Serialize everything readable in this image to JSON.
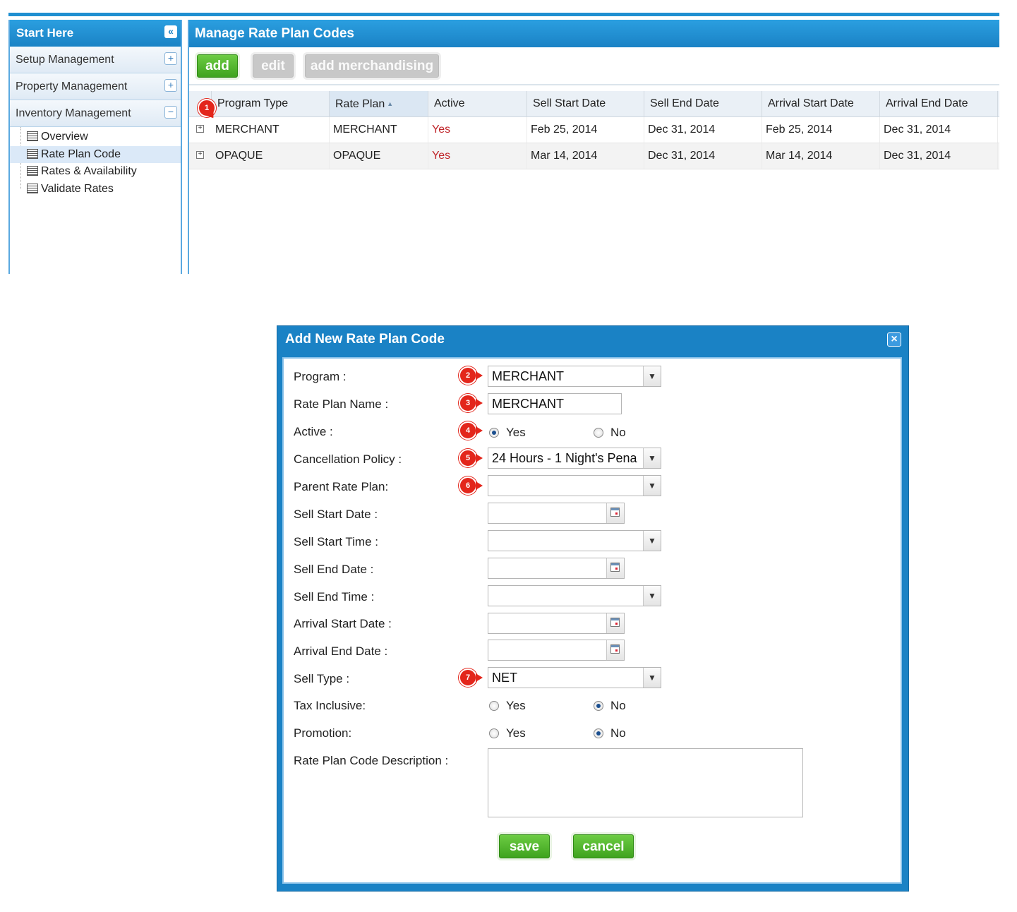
{
  "sidebar": {
    "title": "Start Here",
    "collapse_icon": "«",
    "sections": [
      {
        "label": "Setup Management",
        "toggle": "+"
      },
      {
        "label": "Property Management",
        "toggle": "+"
      },
      {
        "label": "Inventory Management",
        "toggle": "−"
      }
    ],
    "tree": [
      {
        "label": "Overview"
      },
      {
        "label": "Rate Plan Code",
        "selected": true
      },
      {
        "label": "Rates & Availability"
      },
      {
        "label": "Validate Rates"
      }
    ]
  },
  "main": {
    "title": "Manage Rate Plan Codes",
    "toolbar": {
      "add": "add",
      "edit": "edit",
      "add_merchandising": "add merchandising"
    },
    "columns": [
      "Program Type",
      "Rate Plan",
      "Active",
      "Sell Start Date",
      "Sell End Date",
      "Arrival Start Date",
      "Arrival End Date"
    ],
    "sort_indicator": "▲",
    "rows": [
      {
        "expander": "+",
        "cells": [
          "MERCHANT",
          "MERCHANT",
          "Yes",
          "Feb 25, 2014",
          "Dec 31, 2014",
          "Feb 25, 2014",
          "Dec 31, 2014"
        ]
      },
      {
        "expander": "+",
        "cells": [
          "OPAQUE",
          "OPAQUE",
          "Yes",
          "Mar 14, 2014",
          "Dec 31, 2014",
          "Mar 14, 2014",
          "Dec 31, 2014"
        ]
      }
    ]
  },
  "markers": [
    "1",
    "2",
    "3",
    "4",
    "5",
    "6",
    "7"
  ],
  "dialog": {
    "title": "Add New Rate Plan Code",
    "close_icon": "×",
    "labels": {
      "program": "Program :",
      "rate_plan_name": "Rate Plan Name :",
      "active": "Active :",
      "cancellation_policy": "Cancellation Policy :",
      "parent_rate_plan": "Parent Rate Plan:",
      "sell_start_date": "Sell Start Date :",
      "sell_start_time": "Sell Start Time :",
      "sell_end_date": "Sell End Date :",
      "sell_end_time": "Sell End Time :",
      "arrival_start_date": "Arrival Start Date :",
      "arrival_end_date": "Arrival End Date :",
      "sell_type": "Sell Type :",
      "tax_inclusive": "Tax Inclusive:",
      "promotion": "Promotion:",
      "description": "Rate Plan Code Description :"
    },
    "values": {
      "program": "MERCHANT",
      "rate_plan_name": "MERCHANT",
      "cancellation_policy": "24 Hours - 1 Night's Pena",
      "parent_rate_plan": "",
      "sell_start_date": "",
      "sell_start_time": "",
      "sell_end_date": "",
      "sell_end_time": "",
      "arrival_start_date": "",
      "arrival_end_date": "",
      "sell_type": "NET",
      "description": ""
    },
    "radio_yes": "Yes",
    "radio_no": "No",
    "active_selected": "Yes",
    "tax_inclusive_selected": "No",
    "promotion_selected": "No",
    "select_arrow": "▼",
    "buttons": {
      "save": "save",
      "cancel": "cancel"
    }
  },
  "colors": {
    "header_blue": "#1a82c5",
    "button_green": "#4fb62b",
    "marker_red": "#e3261b",
    "active_yes_red": "#c0262b"
  }
}
